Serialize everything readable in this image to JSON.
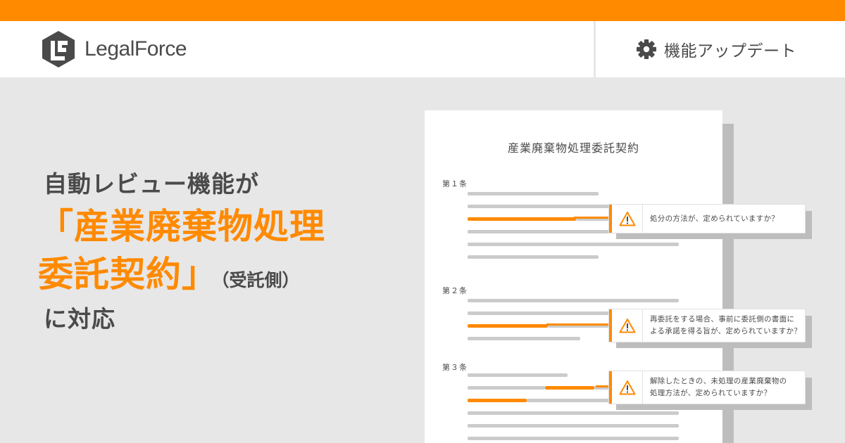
{
  "header": {
    "logo_text": "LegalForce",
    "section_label": "機能アップデート",
    "section_icon": "gear-icon",
    "accent_color": "#ff8a00"
  },
  "headline": {
    "line1": "自動レビュー機能が",
    "line2": "「産業廃棄物処理",
    "line3": "委託契約」",
    "line3_sub": "（受託側）",
    "line4": "に対応"
  },
  "document": {
    "title": "産業廃棄物処理委託契約",
    "clauses": [
      {
        "label": "第１条",
        "alert": [
          "処分の方法が、定められていますか？"
        ],
        "alert_icon": "warning-icon"
      },
      {
        "label": "第２条",
        "alert": [
          "再委託をする場合、事前に委託側の書面に",
          "よる承諾を得る旨が、定められていますか？"
        ],
        "alert_icon": "warning-icon"
      },
      {
        "label": "第３条",
        "alert": [
          "解除したときの、未処理の産業廃棄物の",
          "処理方法が、定められていますか？"
        ],
        "alert_icon": "warning-icon"
      }
    ]
  }
}
